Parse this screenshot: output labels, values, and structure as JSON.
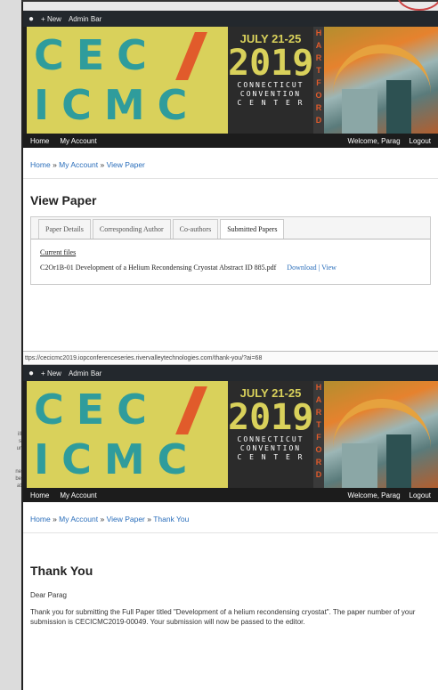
{
  "gutter_text": [
    "ill",
    "s",
    "ur",
    "",
    "ne",
    "be",
    "at"
  ],
  "admin_bar": {
    "new_label": "+ New",
    "admin_label": "Admin Bar"
  },
  "banner": {
    "letters_row1": "CEC",
    "letters_row2": "ICMC",
    "dates": "JULY 21-25",
    "year": "2019",
    "venue": [
      "CONNECTICUT",
      "CONVENTION",
      "C E N T E R"
    ],
    "city_vertical": [
      "H",
      "A",
      "R",
      "T",
      "F",
      "O",
      "R",
      "D"
    ]
  },
  "nav": {
    "home": "Home",
    "account": "My Account",
    "welcome": "Welcome, Parag",
    "logout": "Logout"
  },
  "shot1": {
    "breadcrumb": [
      "Home",
      "My Account",
      "View Paper"
    ],
    "title": "View Paper",
    "tabs": [
      "Paper Details",
      "Corresponding Author",
      "Co-authors",
      "Submitted Papers"
    ],
    "current_files_label": "Current files",
    "file_name": "C2Or1B-01 Development of a Helium Recondensing Cryostat Abstract ID 885.pdf",
    "download": "Download",
    "view": "View"
  },
  "url": "ttps://cecicmc2019.iopconferenceseries.rivervalleytechnologies.com/thank-you/?ai=68",
  "shot2": {
    "breadcrumb": [
      "Home",
      "My Account",
      "View Paper",
      "Thank You"
    ],
    "title": "Thank You",
    "greeting": "Dear Parag",
    "message": "Thank you for submitting the Full Paper titled \"Development of a helium recondensing cryostat\". The paper number of your submission is CECICMC2019-00049. Your submission will now be passed to the editor."
  },
  "colors": {
    "teal": "#2f9c9c",
    "yellow": "#d9d15b",
    "orange": "#e15b2b",
    "link": "#2a6ebb",
    "dark": "#23282d"
  }
}
